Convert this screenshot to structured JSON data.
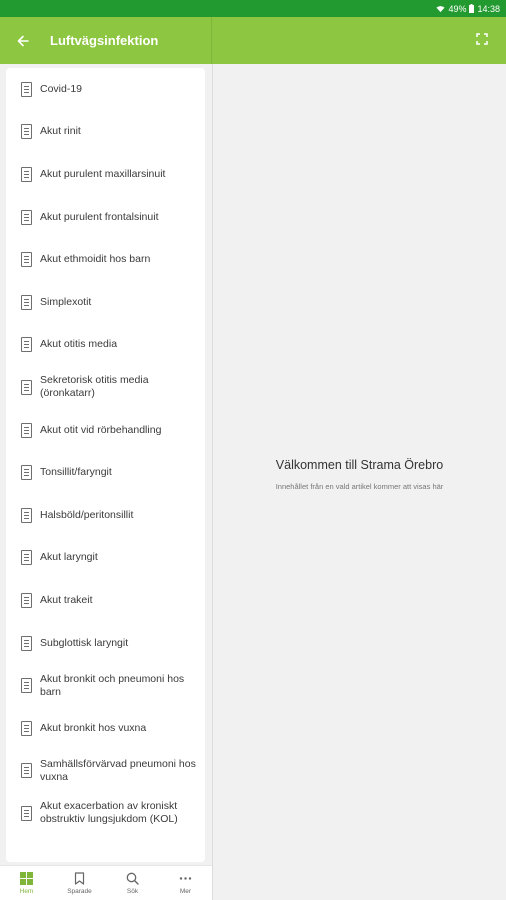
{
  "status": {
    "battery": "49%",
    "time": "14:38"
  },
  "appbar": {
    "title": "Luftvägsinfektion"
  },
  "list": {
    "items": [
      {
        "label": "Covid-19"
      },
      {
        "label": "Akut rinit"
      },
      {
        "label": "Akut purulent maxillarsinuit"
      },
      {
        "label": "Akut purulent frontalsinuit"
      },
      {
        "label": "Akut ethmoidit hos barn"
      },
      {
        "label": "Simplexotit"
      },
      {
        "label": "Akut otitis media"
      },
      {
        "label": "Sekretorisk otitis media (öronkatarr)"
      },
      {
        "label": "Akut otit vid rörbehandling"
      },
      {
        "label": "Tonsillit/faryngit"
      },
      {
        "label": "Halsböld/peritonsillit"
      },
      {
        "label": "Akut laryngit"
      },
      {
        "label": "Akut trakeit"
      },
      {
        "label": "Subglottisk laryngit"
      },
      {
        "label": "Akut bronkit och pneumoni hos barn"
      },
      {
        "label": "Akut bronkit hos vuxna"
      },
      {
        "label": "Samhällsförvärvad pneumoni hos vuxna"
      },
      {
        "label": "Akut exacerbation av kroniskt obstruktiv lungsjukdom (KOL)"
      }
    ]
  },
  "detail": {
    "welcome": "Välkommen till Strama Örebro",
    "hint": "Innehållet från en vald artikel kommer att visas här"
  },
  "bottomnav": {
    "items": [
      {
        "label": "Hem",
        "icon": "grid-icon",
        "active": true
      },
      {
        "label": "Sparade",
        "icon": "bookmark-icon",
        "active": false
      },
      {
        "label": "Sök",
        "icon": "search-icon",
        "active": false
      },
      {
        "label": "Mer",
        "icon": "more-icon",
        "active": false
      }
    ]
  },
  "colors": {
    "appbar": "#8dc641",
    "statusbar": "#239a2f",
    "accent": "#7fb63a"
  }
}
